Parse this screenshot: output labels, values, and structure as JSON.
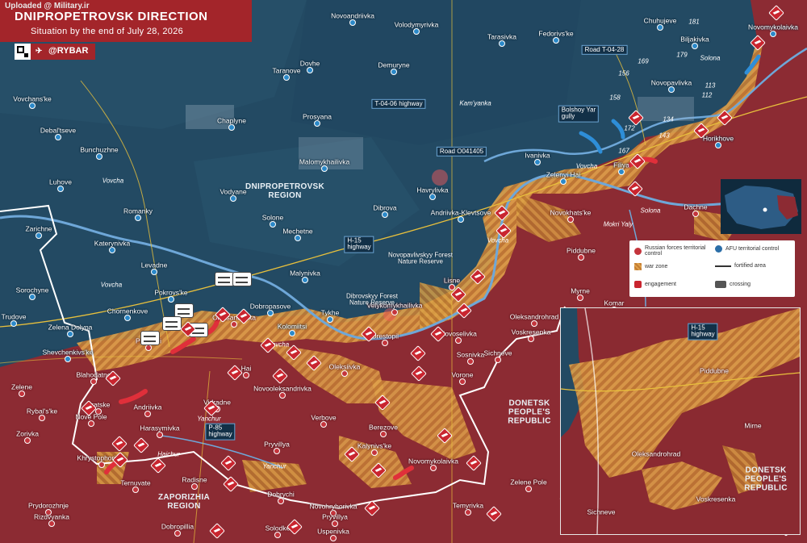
{
  "header": {
    "uploaded": "Uploaded @ Military.ir",
    "title": "DNIPROPETROVSK DIRECTION",
    "subtitle": "Situation by the end of July 28, 2026",
    "handle": "@RYBAR",
    "telegram_icon": "telegram-icon"
  },
  "regions": [
    {
      "id": "dnipropetrovsk",
      "label": "DNIPROPETROVSK\nREGION"
    },
    {
      "id": "zaporizhia",
      "label": "ZAPORIZHIA\nREGION"
    },
    {
      "id": "donetsk",
      "label": "DONETSK\nPEOPLE'S\nREPUBLIC"
    }
  ],
  "towns_afu": [
    "Novoandriivka",
    "Volodymyrivka",
    "Tarasivka",
    "Fedorivs'ke",
    "Chuhujeve",
    "Biljakivka",
    "Novomykolaivka",
    "Dovhe",
    "Demuryne",
    "Taranove",
    "Vovchans'ke",
    "Debal'tseve",
    "Chaplyne",
    "Prosyana",
    "Bunchuzhne",
    "Malomykhailivka",
    "Luhove",
    "Vodyane",
    "Romanky",
    "Solone",
    "Zarichne",
    "Mechetne",
    "Dibrova",
    "Katerynivka",
    "Levadne",
    "Malynivka",
    "Sorochyne",
    "Pokrovs'ke",
    "Chornenkove",
    "Trudove",
    "Dobropasove",
    "Zelena Dolyna",
    "Tykhe",
    "Kolomiitsi",
    "Shevchenkivs'ke",
    "Ivanivka",
    "Horikhove",
    "Novopavlivka",
    "Zelenyi Hai",
    "Andriivka-Klevtsove",
    "Havrylivka",
    "Filiya"
  ],
  "towns_ru": [
    "Oleksandrivka",
    "Pysantsi",
    "Blahodatne",
    "Zelene",
    "Rybal's'ke",
    "Bratske",
    "Nove Pole",
    "Andriivka",
    "Zorivka",
    "Harasymivka",
    "Vidradne",
    "Hai",
    "Novooleksandrivka",
    "Oleksiivka",
    "Verbove",
    "Pryvillya",
    "Khrystophorivka",
    "Radisne",
    "Ternuvate",
    "Prydorozhnje",
    "Rizdvyanka",
    "Dobropillia",
    "Dobrychi",
    "Novohryhorivka",
    "Pryvillya",
    "Solodke",
    "Uspenivka",
    "Berezove",
    "Kalynivs'ke",
    "Novomykolaivka",
    "Zelene Pole",
    "Temyrivka",
    "Sosnivka",
    "Vorone",
    "Orestopil",
    "Velykomykhailivka",
    "Novoselivka",
    "Lisne",
    "Sichneve",
    "Oleksandrohrad",
    "Voskresenka",
    "Myrne",
    "Komar",
    "Piddubne",
    "Novokhats'ke",
    "Dachne"
  ],
  "rivers": [
    "Vovcha",
    "Vovcha",
    "Vovcha",
    "Vovcha",
    "Vovcha",
    "Yanchur",
    "Yanchur",
    "Haichur",
    "Mokri Yaly",
    "Solona",
    "Kam'yanka",
    "Solona"
  ],
  "roads": [
    {
      "label": "T-04-06 highway"
    },
    {
      "label": "Road O041405"
    },
    {
      "label": "Road T-04-28"
    },
    {
      "label": "H-15\nhighway"
    },
    {
      "label": "P-85\nhighway"
    },
    {
      "label": "Bolshoy Yar\ngully"
    }
  ],
  "forests": [
    "Novopavlivskyy Forest\nNature Reserve",
    "Dibrovskyy Forest\nNature Reserve"
  ],
  "heights": [
    "181",
    "179",
    "169",
    "156",
    "158",
    "112",
    "113",
    "134",
    "143",
    "172",
    "167"
  ],
  "legend": {
    "ru_control": "Russian forces territorial control",
    "afu_control": "AFU territorial control",
    "war_zone": "war zone",
    "fortified": "fortified area",
    "engagement": "engagement",
    "crossing": "crossing"
  },
  "inset": {
    "road": "H-15\nhighway",
    "towns": [
      "Piddubne",
      "Mirne",
      "Oleksandrohrad",
      "Voskresenka",
      "Sichneve"
    ],
    "region": "DONETSK\nPEOPLE'S\nREPUBLIC"
  },
  "colors": {
    "afu": "#244a63",
    "ru": "#8c2b33",
    "war_zone": "#d99a3f",
    "accent": "#a3252a"
  }
}
